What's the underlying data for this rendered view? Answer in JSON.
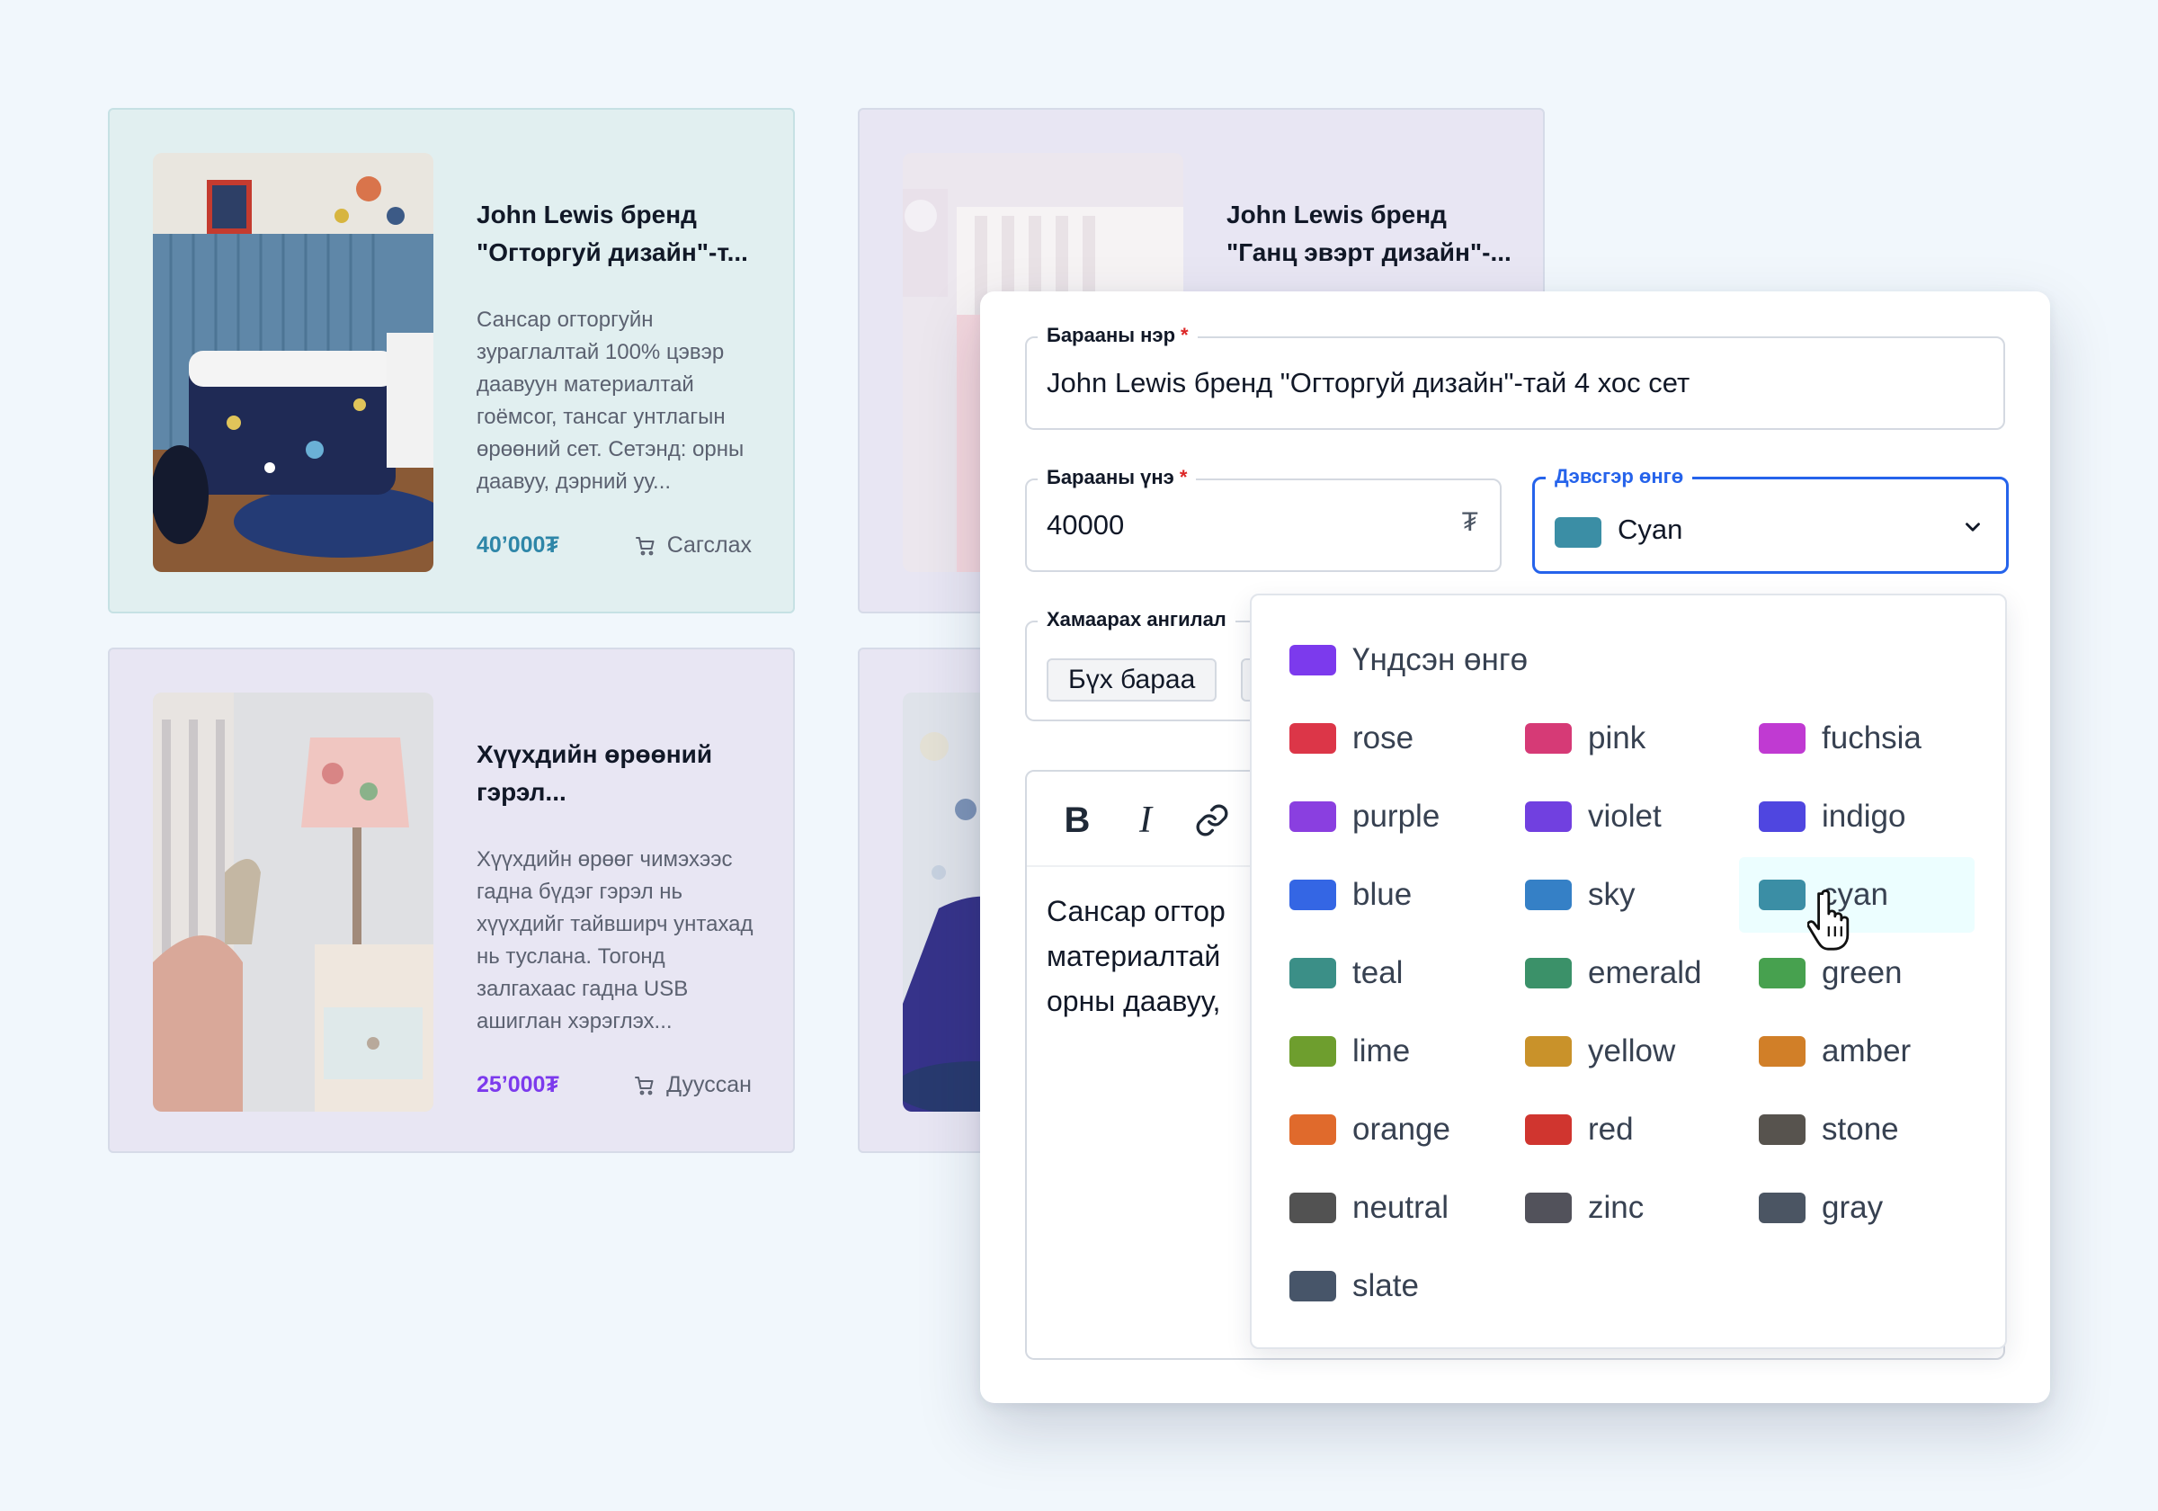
{
  "products": [
    {
      "title": "John Lewis бренд \"Огторгуй дизайн\"-т...",
      "description": "Сансар огторгуйн зураглалтай 100% цэвэр даавуун материалтай гоёмсог, тансаг унтлагын өрөөний сет. Сетэнд: орны даавуу, дэрний уу...",
      "price": "40’000₮",
      "price_color": "#2e86a8",
      "action": "Сагслах",
      "action_icon": "cart-icon"
    },
    {
      "title": "John Lewis бренд \"Ганц эвэрт дизайн\"-...",
      "description": "",
      "price": "",
      "action": ""
    },
    {
      "title": "Хүүхдийн өрөөний гэрэл...",
      "description": "Хүүхдийн өрөөг чимэхээс гадна бүдэг гэрэл нь хүүхдийг тайвширч унтахад нь туслана. Тогонд залгахаас гадна USB ашиглан хэрэглэх...",
      "price": "25’000₮",
      "price_color": "#7c3aed",
      "action": "Дууссан",
      "action_icon": "cart-icon"
    }
  ],
  "form": {
    "name_label": "Барааны нэр",
    "name_value": "John Lewis бренд \"Огторгуй дизайн\"-тай 4 хос сет",
    "price_label": "Барааны үнэ",
    "price_value": "40000",
    "currency_symbol": "₮",
    "bg_color_label": "Дэвсгэр өнгө",
    "bg_color_value": "Cyan",
    "bg_color_swatch": "#3b8ea5",
    "category_label": "Хамаарах ангилал",
    "category_chip": "Бүх бараа",
    "required_mark": "*",
    "toolbar": {
      "bold": "B",
      "italic": "I",
      "link_icon": "link-icon"
    },
    "editor_lines": [
      "Сансар огтор",
      "материалтай",
      "орны даавуу,"
    ]
  },
  "color_options": {
    "default": {
      "label": "Үндсэн өнгө",
      "color": "#7c3aed"
    },
    "items": [
      {
        "label": "rose",
        "color": "#dc3648"
      },
      {
        "label": "pink",
        "color": "#d63a76"
      },
      {
        "label": "fuchsia",
        "color": "#c03ad2"
      },
      {
        "label": "purple",
        "color": "#8a3fe0"
      },
      {
        "label": "violet",
        "color": "#7140e0"
      },
      {
        "label": "indigo",
        "color": "#4f46e0"
      },
      {
        "label": "blue",
        "color": "#3466e4"
      },
      {
        "label": "sky",
        "color": "#3580c6"
      },
      {
        "label": "cyan",
        "color": "#3b8ea5"
      },
      {
        "label": "teal",
        "color": "#3b8f87"
      },
      {
        "label": "emerald",
        "color": "#3b9169"
      },
      {
        "label": "green",
        "color": "#47a14f"
      },
      {
        "label": "lime",
        "color": "#6e9e2e"
      },
      {
        "label": "yellow",
        "color": "#c9922a"
      },
      {
        "label": "amber",
        "color": "#d17f28"
      },
      {
        "label": "orange",
        "color": "#e06a2c"
      },
      {
        "label": "red",
        "color": "#d0352f"
      },
      {
        "label": "stone",
        "color": "#57534e"
      },
      {
        "label": "neutral",
        "color": "#525252"
      },
      {
        "label": "zinc",
        "color": "#52525b"
      },
      {
        "label": "gray",
        "color": "#4b5563"
      },
      {
        "label": "slate",
        "color": "#475569"
      }
    ],
    "hovered": "cyan"
  }
}
